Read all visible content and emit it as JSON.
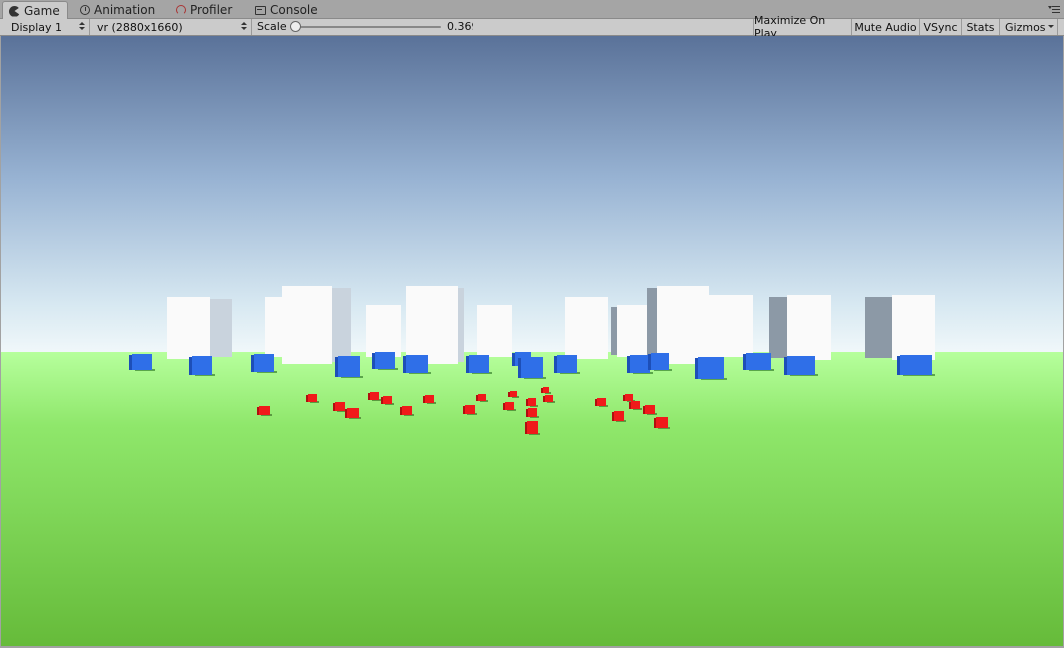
{
  "tabs": [
    {
      "label": "Game",
      "icon": "game-icon",
      "active": true
    },
    {
      "label": "Animation",
      "icon": "animation-clock-icon",
      "active": false
    },
    {
      "label": "Profiler",
      "icon": "profiler-gauge-icon",
      "active": false
    },
    {
      "label": "Console",
      "icon": "console-icon",
      "active": false
    }
  ],
  "toolbar": {
    "display": "Display 1",
    "resolution": "vr (2880x1660)",
    "scale_label": "Scale",
    "scale_value": "0.369",
    "scale_fraction": 0.0,
    "maximize": "Maximize On Play",
    "mute": "Mute Audio",
    "vsync": "VSync",
    "stats": "Stats",
    "gizmos": "Gizmos"
  },
  "colors": {
    "sky_top": "#5a7299",
    "sky_horizon": "#f1f8fa",
    "ground_near": "#69be3c",
    "ground_far": "#a6ff86",
    "white_block": "#fafafa",
    "blue_cube": "#2f6fe8",
    "red_cube": "#f01a1a"
  }
}
